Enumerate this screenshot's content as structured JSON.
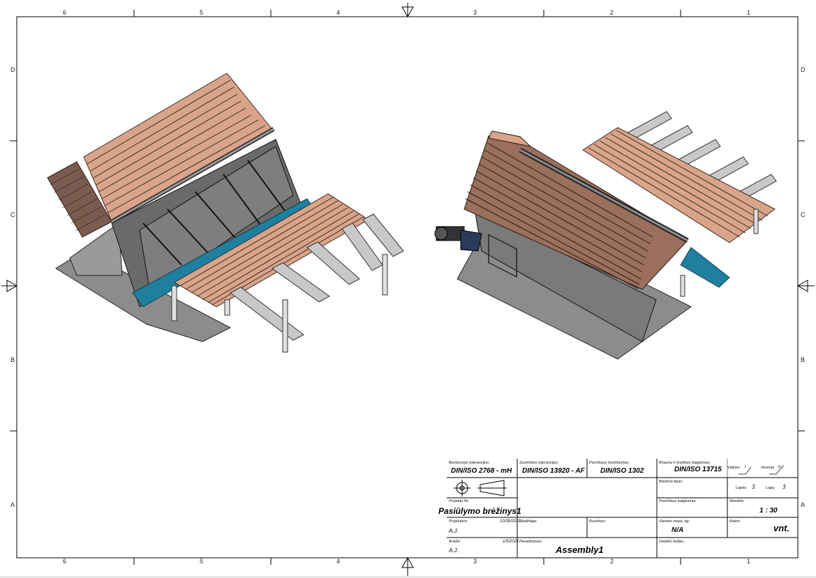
{
  "frame": {
    "columns_top": [
      "6",
      "5",
      "4",
      "3",
      "2",
      "1"
    ],
    "columns_bottom": [
      "6",
      "5",
      "4",
      "3",
      "2",
      "1"
    ],
    "rows_left": [
      "D",
      "C",
      "B",
      "A"
    ],
    "rows_right": [
      "D",
      "C",
      "B",
      "A"
    ]
  },
  "title_block": {
    "general_tol_label": "Bendrosios tolerancijos:",
    "general_tol_value": "DIN/ISO 2768 - mH",
    "weld_tol_label": "Suvirinimo tolerancijos:",
    "weld_tol_value": "DIN/ISO 13920 - AF",
    "roughness_label": "Paviršiaus šiurkštumas:",
    "roughness_value": "DIN/ISO 1302",
    "edge_label": "Briaunų ir kraštinių baigtumas:",
    "edge_value": "DIN/ISO 13715",
    "internal_label": "Vidinės",
    "internal_value": "+",
    "external_label": "Išorinės",
    "external_value": "-0,3",
    "drawing_type_label": "Brėžinio tipas:",
    "sheet_label": "Lapas:",
    "sheet_value": "3",
    "sheets_label": "Lapų:",
    "sheets_value": "3",
    "project_no_label": "Projekto Nr.:",
    "project_name": "Pasiūlymo brėžinys1",
    "surface_label": "Paviršiaus baigtumas:",
    "scale_label": "Mastelis:",
    "scale_value": "1 : 30",
    "designed_label": "Projektavo:",
    "designed_date": "10/30/2021",
    "designed_by": "A.J.",
    "material_label": "Medžiaga:",
    "checked_label": "Ruošinys:",
    "unit_mass_label": "Vieneto masė, kg:",
    "unit_mass_value": "N/A",
    "qty_label": "Kiekis:",
    "qty_value": "vnt.",
    "drawn_label": "Braižė:",
    "drawn_date": "1/5/2021",
    "drawn_by": "A.J.",
    "name_label": "Pavadinimas:",
    "name_value": "Assembly1",
    "detail_code_label": "Detalės kodas.:"
  }
}
